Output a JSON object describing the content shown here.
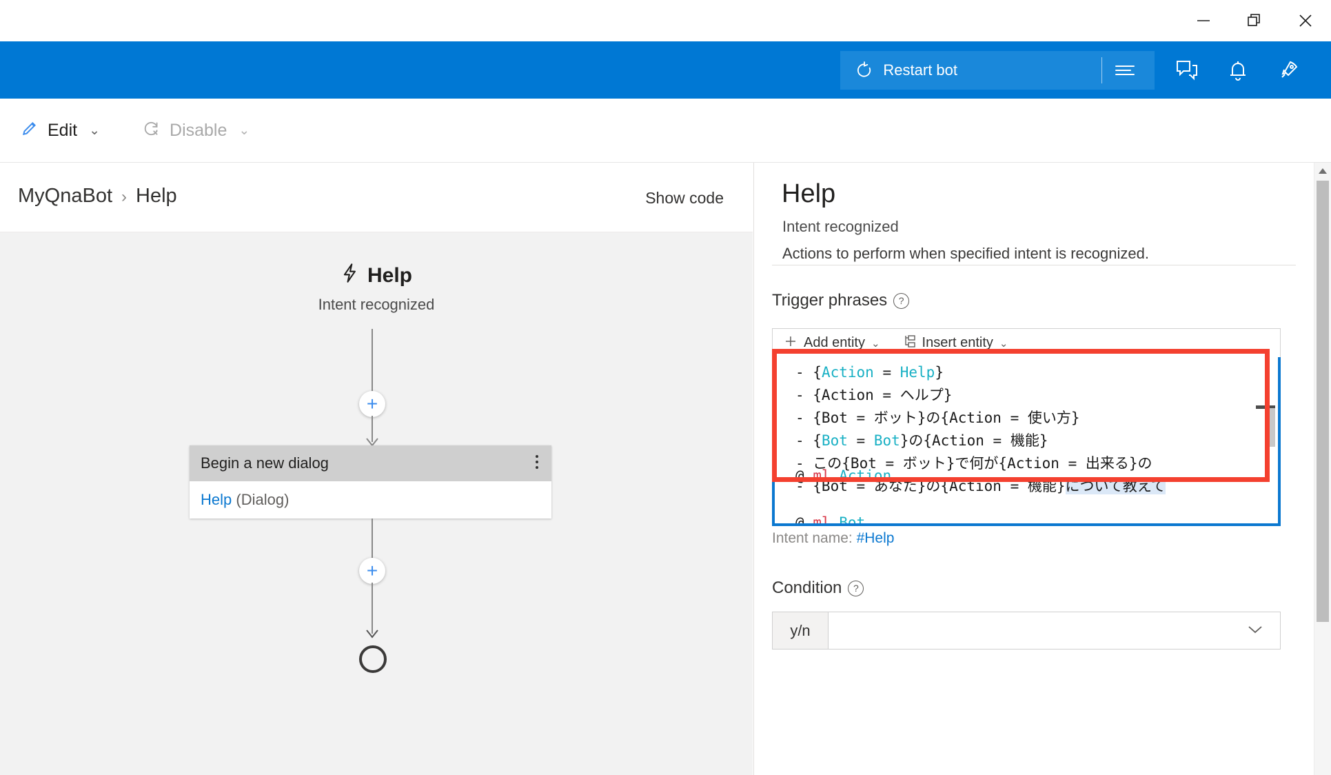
{
  "window": {
    "controls": [
      {
        "name": "minimize",
        "glyph": "minimize-icon"
      },
      {
        "name": "restore",
        "glyph": "restore-icon"
      },
      {
        "name": "close",
        "glyph": "close-icon"
      }
    ]
  },
  "bluebar": {
    "background_color": "#0078d4",
    "restart_button_bg": "#1a88da",
    "restart_label": "Restart bot",
    "restart_icon": "restart-icon",
    "menu_icon": "hamburger-lines-icon",
    "icons": [
      {
        "name": "chat-icon",
        "label": "Chat"
      },
      {
        "name": "bell-icon",
        "label": "Notifications"
      },
      {
        "name": "rocket-icon",
        "label": "Publish"
      }
    ]
  },
  "commandbar": {
    "edit_label": "Edit",
    "edit_icon": "pencil-icon",
    "disable_label": "Disable",
    "disable_icon": "disable-refresh-icon",
    "chevron": "⌄"
  },
  "canvas": {
    "breadcrumb": {
      "root": "MyQnaBot",
      "separator": "›",
      "current": "Help"
    },
    "show_code_label": "Show code",
    "node": {
      "title": "Help",
      "icon": "lightning-bolt-icon",
      "subtitle": "Intent recognized"
    },
    "card": {
      "header": "Begin a new dialog",
      "overflow_icon": "more-vertical-icon",
      "body_link": "Help",
      "body_suffix": "(Dialog)"
    },
    "plus_label": "+",
    "background_color": "#f2f2f2"
  },
  "properties": {
    "title": "Help",
    "subtitle": "Intent recognized",
    "description": "Actions to perform when specified intent is recognized.",
    "trigger_phrases": {
      "label": "Trigger phrases",
      "help_icon": "help-circle-icon",
      "toolbar": {
        "add_entity_label": "Add entity",
        "add_entity_icon": "plus-icon",
        "insert_entity_label": "Insert entity",
        "insert_entity_icon": "tree-hierarchy-icon",
        "chevron": "⌄"
      },
      "lines": [
        [
          {
            "t": "- {",
            "c": "plain"
          },
          {
            "t": "Action",
            "c": "entity"
          },
          {
            "t": " = ",
            "c": "plain"
          },
          {
            "t": "Help",
            "c": "entity"
          },
          {
            "t": "}",
            "c": "plain"
          }
        ],
        [
          {
            "t": "- {Action = ヘルプ}",
            "c": "plain"
          }
        ],
        [
          {
            "t": "- {Bot = ボット}の{Action = 使い方}",
            "c": "plain"
          }
        ],
        [
          {
            "t": "- {",
            "c": "plain"
          },
          {
            "t": "Bot",
            "c": "entity"
          },
          {
            "t": " = ",
            "c": "plain"
          },
          {
            "t": "Bot",
            "c": "entity"
          },
          {
            "t": "}の{Action = 機能}",
            "c": "plain"
          }
        ],
        [
          {
            "t": "- この{Bot = ボット}で何が{Action = 出来る}の",
            "c": "plain"
          }
        ],
        [
          {
            "t": "- {Bot = あなた}の{Action = 機能}",
            "c": "plain"
          },
          {
            "t": "について教えて",
            "c": "selected"
          }
        ]
      ],
      "entity_declarations": [
        [
          {
            "t": "@",
            "c": "at"
          },
          {
            "t": " ",
            "c": "plain"
          },
          {
            "t": "ml",
            "c": "ml"
          },
          {
            "t": " ",
            "c": "plain"
          },
          {
            "t": "Action",
            "c": "entity"
          }
        ],
        [
          {
            "t": "@",
            "c": "at"
          },
          {
            "t": " ",
            "c": "plain"
          },
          {
            "t": "ml",
            "c": "ml"
          },
          {
            "t": " ",
            "c": "plain"
          },
          {
            "t": "Bot",
            "c": "entity"
          }
        ]
      ],
      "annotation_color": "#f4402f",
      "editor_border_color": "#0b78d0",
      "cursor_icon": "text-ibeam-cursor"
    },
    "intent_name": {
      "prefix": "Intent name: ",
      "value": "#Help"
    },
    "condition": {
      "label": "Condition",
      "help_icon": "help-circle-icon",
      "prefix_badge": "y/n",
      "value": "",
      "chevron": "⌄"
    }
  },
  "scrollbar": {
    "up_arrow_icon": "caret-up-icon"
  }
}
